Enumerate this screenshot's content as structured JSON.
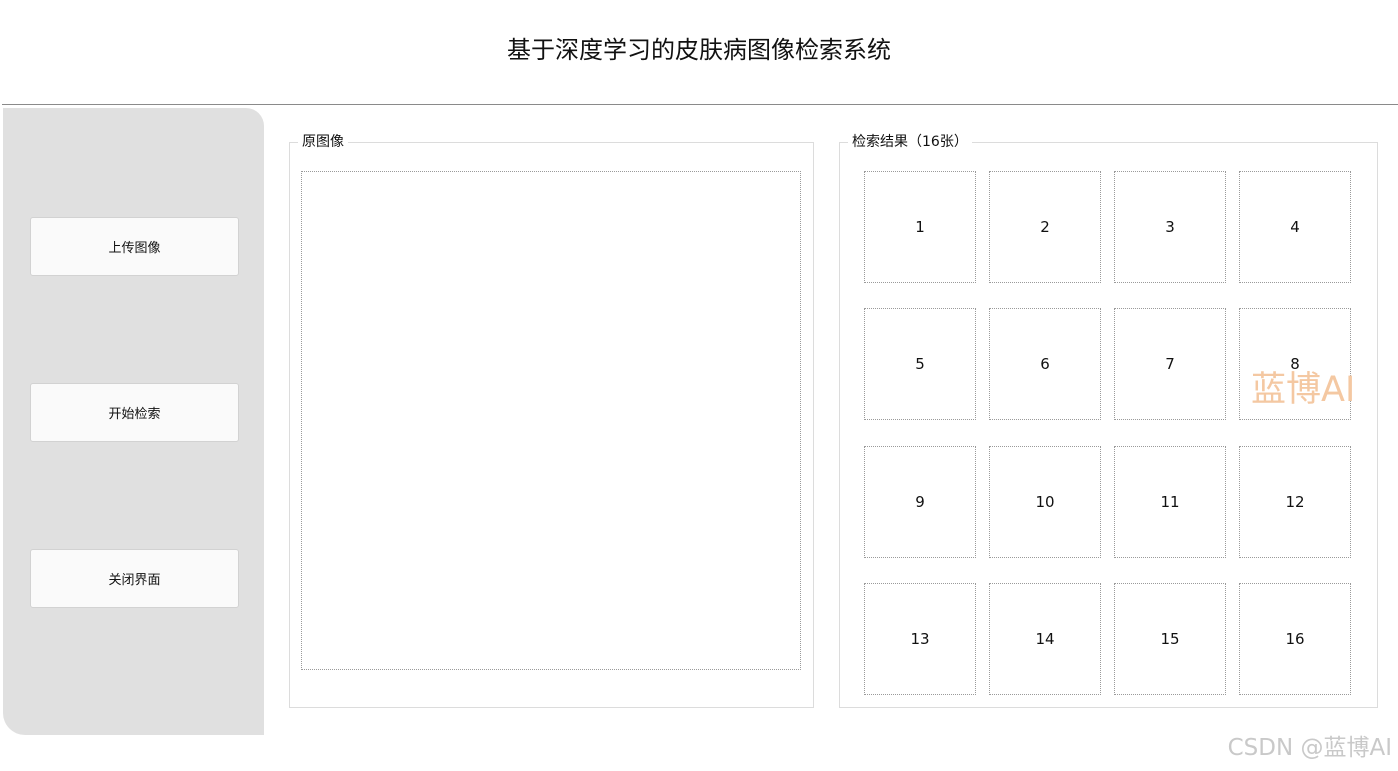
{
  "app": {
    "title": "基于深度学习的皮肤病图像检索系统"
  },
  "sidebar": {
    "buttons": [
      {
        "label": "上传图像"
      },
      {
        "label": "开始检索"
      },
      {
        "label": "关闭界面"
      }
    ]
  },
  "original_panel": {
    "title": "原图像"
  },
  "results_panel": {
    "title": "检索结果（16张）",
    "cells": [
      "1",
      "2",
      "3",
      "4",
      "5",
      "6",
      "7",
      "8",
      "9",
      "10",
      "11",
      "12",
      "13",
      "14",
      "15",
      "16"
    ]
  },
  "watermarks": {
    "center": "蓝博AI",
    "corner": "CSDN @蓝博AI"
  },
  "colors": {
    "sidebar_bg": "#e0e0e0",
    "button_bg": "#fafafa",
    "watermark_orange": "#f4c8a2"
  }
}
